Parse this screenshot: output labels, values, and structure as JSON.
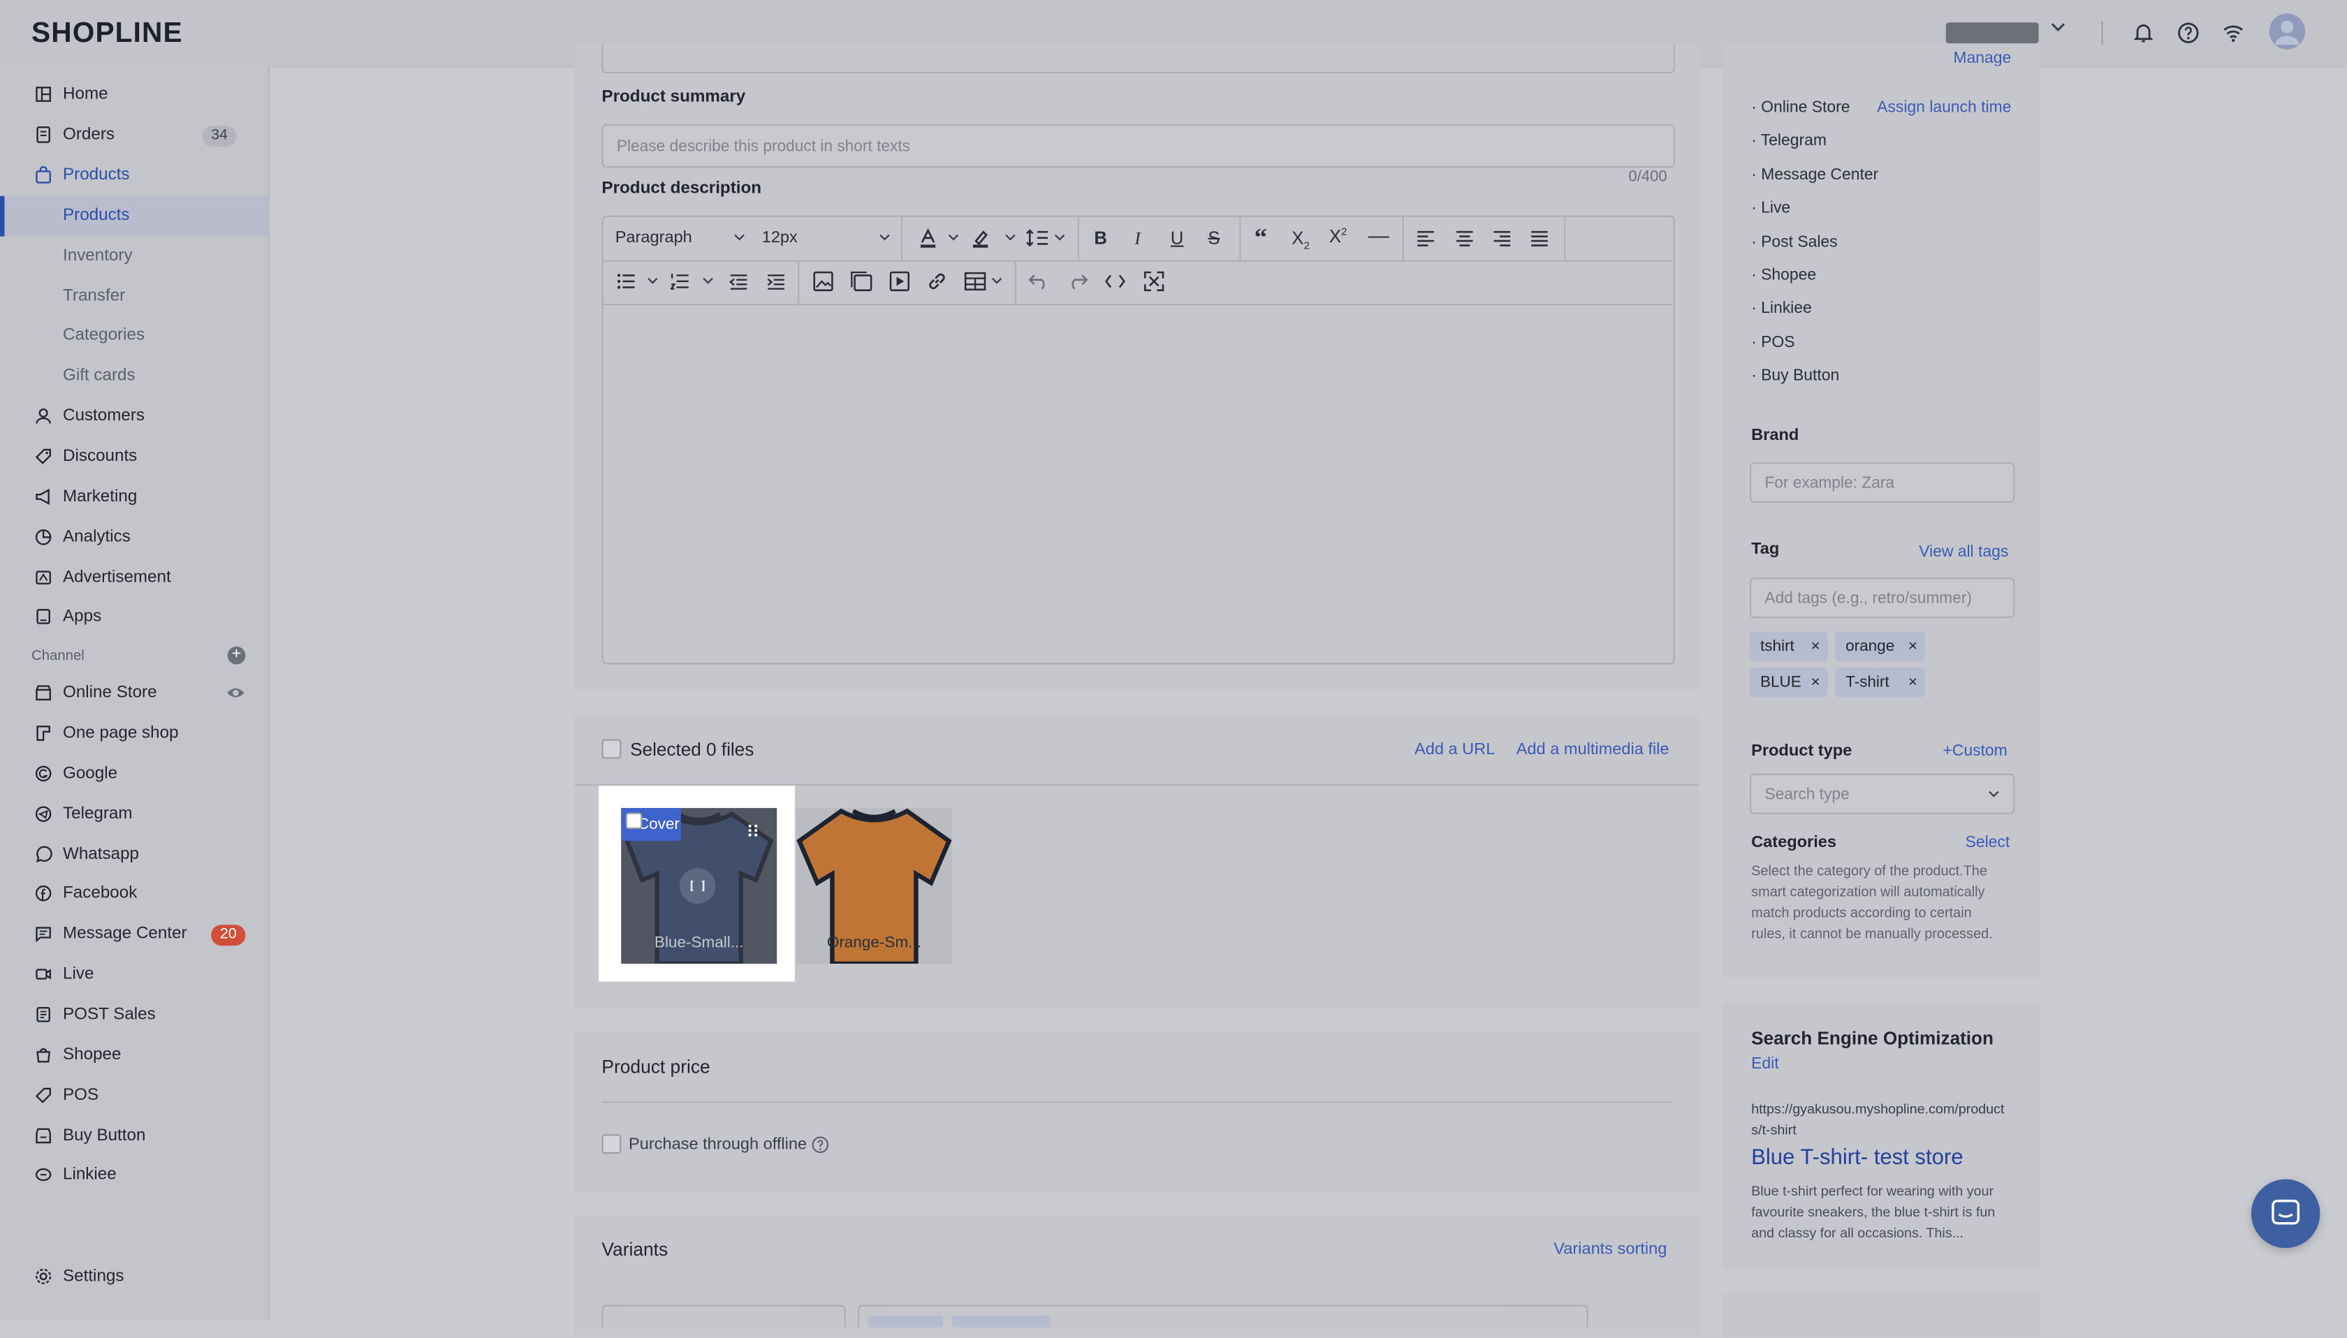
{
  "app": {
    "logo": "SHOPLINE",
    "store_name": "",
    "colors": {
      "accent": "#3b5ab6",
      "badge_red": "#d14f38",
      "badge_gray": "#b3b5ba"
    }
  },
  "sidebar": {
    "items": [
      {
        "label": "Home",
        "icon": "home-icon"
      },
      {
        "label": "Orders",
        "icon": "orders-icon",
        "badge": "34"
      },
      {
        "label": "Products",
        "icon": "bag-icon"
      },
      {
        "label": "Products",
        "sub": true
      },
      {
        "label": "Inventory",
        "sub": true
      },
      {
        "label": "Transfer",
        "sub": true
      },
      {
        "label": "Categories",
        "sub": true
      },
      {
        "label": "Gift cards",
        "sub": true
      },
      {
        "label": "Customers",
        "icon": "user-icon"
      },
      {
        "label": "Discounts",
        "icon": "tag-icon"
      },
      {
        "label": "Marketing",
        "icon": "megaphone-icon"
      },
      {
        "label": "Analytics",
        "icon": "chart-icon"
      },
      {
        "label": "Advertisement",
        "icon": "ad-icon"
      },
      {
        "label": "Apps",
        "icon": "apps-icon"
      }
    ],
    "channel_label": "Channel",
    "channels": [
      {
        "label": "Online Store",
        "icon": "store-icon"
      },
      {
        "label": "One page shop",
        "icon": "page-icon"
      },
      {
        "label": "Google",
        "icon": "google-icon"
      },
      {
        "label": "Telegram",
        "icon": "telegram-icon"
      },
      {
        "label": "Whatsapp",
        "icon": "whatsapp-icon"
      },
      {
        "label": "Facebook",
        "icon": "facebook-icon"
      },
      {
        "label": "Message Center",
        "icon": "message-icon",
        "badge": "20"
      },
      {
        "label": "Live",
        "icon": "live-icon"
      },
      {
        "label": "POST Sales",
        "icon": "post-icon"
      },
      {
        "label": "Shopee",
        "icon": "shopee-icon"
      },
      {
        "label": "POS",
        "icon": "pos-icon"
      },
      {
        "label": "Buy Button",
        "icon": "buy-icon"
      },
      {
        "label": "Linkiee",
        "icon": "link-icon"
      }
    ],
    "settings": "Settings"
  },
  "main": {
    "summary_label": "Product summary",
    "summary_placeholder": "Please describe this product in short texts",
    "summary_count": "0/400",
    "description_label": "Product description",
    "editor": {
      "paragraph": "Paragraph",
      "size": "12px"
    },
    "media": {
      "selected": "Selected 0 files",
      "add_url": "Add a URL",
      "add_media": "Add a multimedia file",
      "cover": "Cover",
      "images": [
        {
          "name": "Blue-Small...",
          "color": "#3d5280"
        },
        {
          "name": "Orange-Sm...",
          "color": "#bf7535"
        }
      ]
    },
    "price": {
      "title": "Product price",
      "offline": "Purchase through offline"
    },
    "variants": {
      "title": "Variants",
      "sorting": "Variants sorting"
    }
  },
  "right": {
    "sales_channels": {
      "manage": "Manage",
      "assign": "Assign launch time",
      "items": [
        "Online Store",
        "Telegram",
        "Message Center",
        "Live",
        "Post Sales",
        "Shopee",
        "Linkiee",
        "POS",
        "Buy Button"
      ]
    },
    "brand": {
      "label": "Brand",
      "placeholder": "For example: Zara"
    },
    "tag": {
      "label": "Tag",
      "view_all": "View all tags",
      "placeholder": "Add tags (e.g., retro/summer)",
      "tags": [
        "tshirt",
        "orange",
        "BLUE",
        "T-shirt"
      ]
    },
    "product_type": {
      "label": "Product type",
      "custom": "+Custom",
      "placeholder": "Search type"
    },
    "categories": {
      "label": "Categories",
      "select": "Select",
      "desc": "Select the category of the product.The smart categorization will automatically match products according to certain rules, it cannot be manually processed."
    },
    "seo": {
      "title": "Search Engine Optimization",
      "edit": "Edit",
      "url": "https://gyakusou.myshopline.com/products/t-shirt",
      "page_title": "Blue T-shirt- test store",
      "desc": "Blue t-shirt perfect for wearing with your favourite sneakers, the blue t-shirt is fun and classy for all occasions. This..."
    }
  }
}
